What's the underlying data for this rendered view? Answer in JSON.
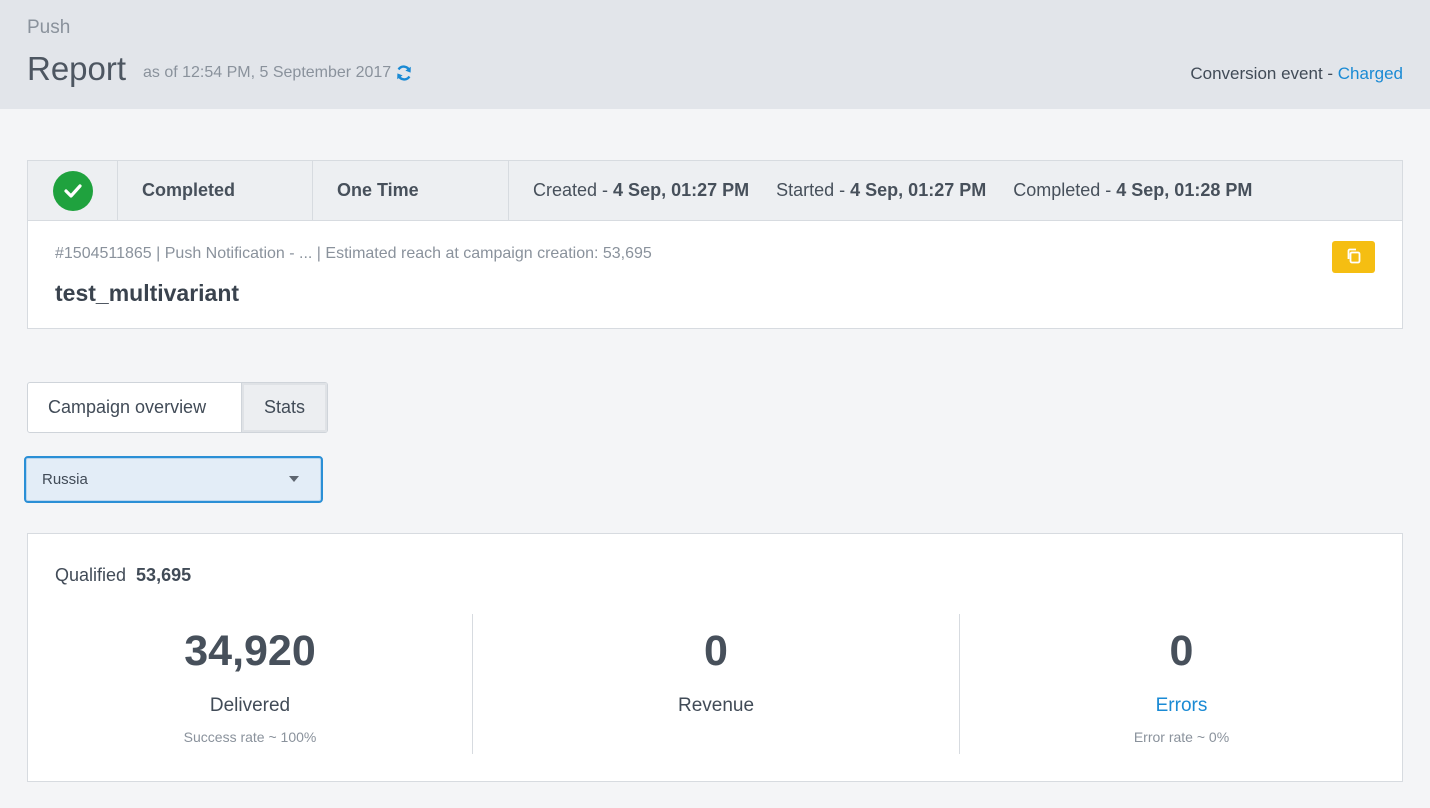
{
  "header": {
    "breadcrumb": "Push",
    "title": "Report",
    "as_of": "as of 12:54 PM, 5 September 2017",
    "conversion_label": "Conversion event - ",
    "conversion_value": "Charged"
  },
  "campaign": {
    "status": "Completed",
    "type": "One Time",
    "created_label": "Created - ",
    "created_value": "4 Sep, 01:27 PM",
    "started_label": "Started - ",
    "started_value": "4 Sep, 01:27 PM",
    "completed_label": "Completed - ",
    "completed_value": "4 Sep, 01:28 PM",
    "meta": "#1504511865 | Push Notification - ... | Estimated reach at campaign creation: 53,695",
    "name": "test_multivariant"
  },
  "tabs": [
    {
      "label": "Campaign overview"
    },
    {
      "label": "Stats"
    }
  ],
  "filter": {
    "selected": "Russia"
  },
  "stats": {
    "qualified_label": "Qualified",
    "qualified_value": "53,695",
    "delivered": {
      "value": "34,920",
      "label": "Delivered",
      "sub": "Success rate ~ 100%"
    },
    "revenue": {
      "value": "0",
      "label": "Revenue"
    },
    "errors": {
      "value": "0",
      "label": "Errors",
      "sub": "Error rate ~ 0%"
    }
  },
  "colors": {
    "success": "#1fa23e",
    "link": "#1a8ad4",
    "copy_button": "#f5be12"
  },
  "icons": [
    "refresh-icon",
    "check-icon",
    "copy-icon",
    "chevron-down-icon"
  ]
}
